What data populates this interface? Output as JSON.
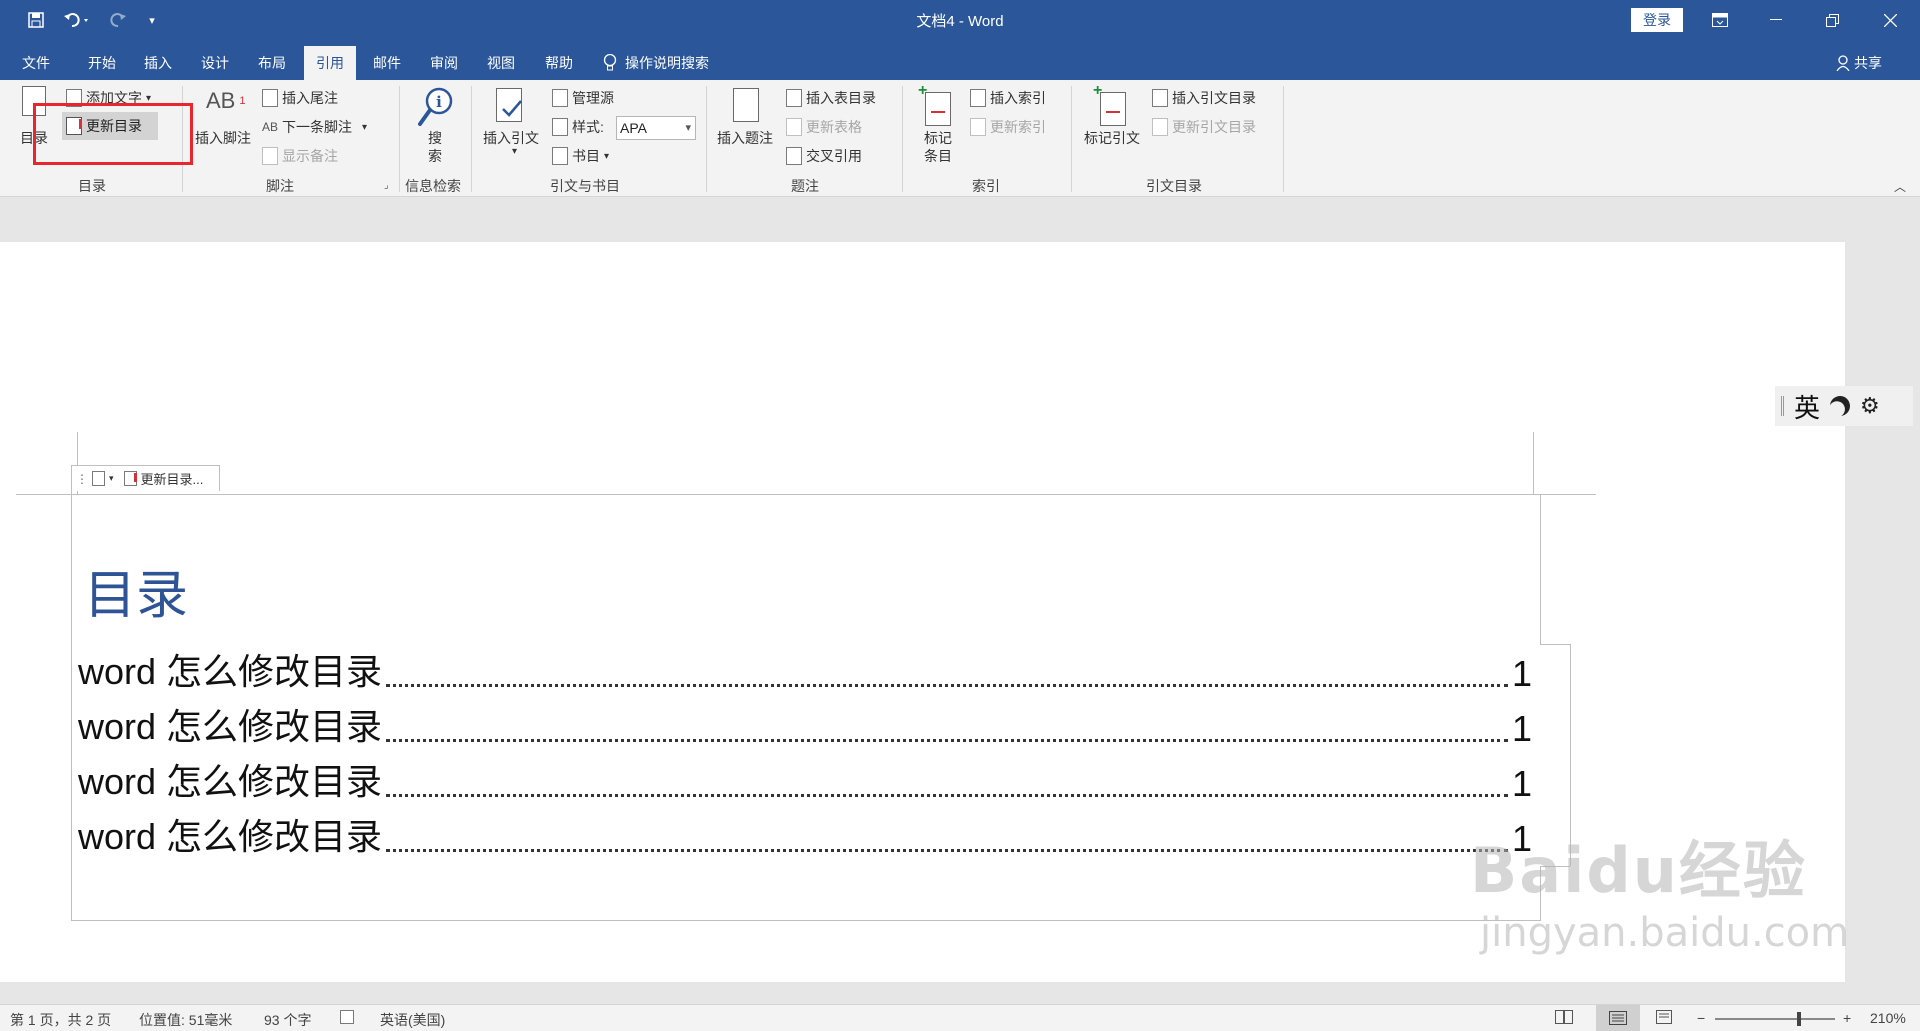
{
  "title_bar": {
    "doc_title": "文档4  -  Word",
    "login_label": "登录",
    "quick_access": [
      "save-icon",
      "undo-icon",
      "redo-icon",
      "customize-icon"
    ]
  },
  "tabs": [
    "文件",
    "开始",
    "插入",
    "设计",
    "布局",
    "引用",
    "邮件",
    "审阅",
    "视图",
    "帮助"
  ],
  "active_tab": "引用",
  "tell_me": "操作说明搜索",
  "share": "共享",
  "ribbon": {
    "toc": {
      "toc_button": "目录",
      "add_text": "添加文字",
      "update_toc": "更新目录",
      "group": "目录"
    },
    "footnotes": {
      "insert_footnote": "插入脚注",
      "insert_endnote": "插入尾注",
      "next_footnote": "下一条脚注",
      "show_notes": "显示备注",
      "group": "脚注"
    },
    "research": {
      "search": "搜",
      "search2": "索",
      "group": "信息检索"
    },
    "citations": {
      "insert_citation": "插入引文",
      "manage_sources": "管理源",
      "style_label": "样式:",
      "style_value": "APA",
      "bibliography": "书目",
      "group": "引文与书目"
    },
    "captions": {
      "insert_caption": "插入题注",
      "insert_table_of_figures": "插入表目录",
      "update_table": "更新表格",
      "cross_reference": "交叉引用",
      "group": "题注"
    },
    "index": {
      "mark_entry_1": "标记",
      "mark_entry_2": "条目",
      "insert_index": "插入索引",
      "update_index": "更新索引",
      "group": "索引"
    },
    "authorities": {
      "mark_citation": "标记引文",
      "insert_table_of_authorities": "插入引文目录",
      "update_table": "更新引文目录",
      "group": "引文目录"
    }
  },
  "document": {
    "toc_control_label": "更新目录...",
    "toc_title": "目录",
    "toc_entries": [
      {
        "text": "word 怎么修改目录",
        "page": "1"
      },
      {
        "text": "word 怎么修改目录",
        "page": "1"
      },
      {
        "text": "word 怎么修改目录",
        "page": "1"
      },
      {
        "text": "word 怎么修改目录",
        "page": "1"
      }
    ]
  },
  "ime": {
    "lang": "英"
  },
  "watermark": {
    "logo": "Baidu经验",
    "url": "jingyan.baidu.com"
  },
  "status_bar": {
    "page": "第 1 页，共 2 页",
    "position": "位置值: 51毫米",
    "words": "93 个字",
    "language": "英语(美国)",
    "zoom_percent": "210%",
    "zoom_level": 0.7
  }
}
